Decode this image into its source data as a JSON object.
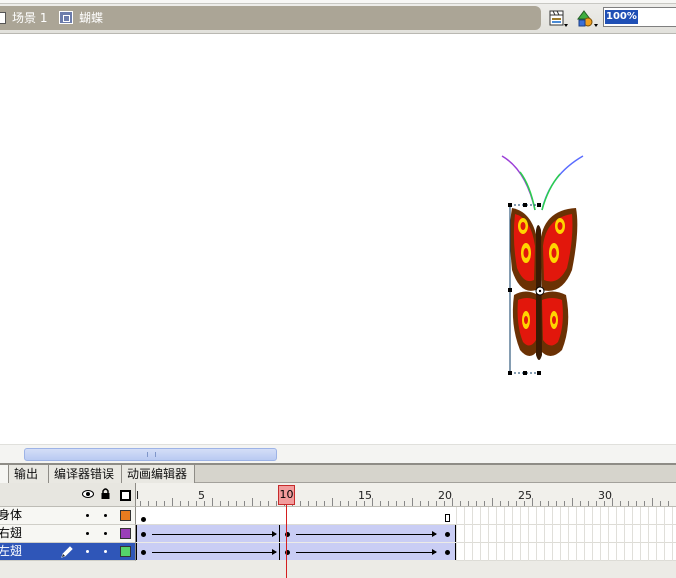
{
  "breadcrumb": {
    "scene": "场景 1",
    "symbol": "蝴蝶"
  },
  "toolbar": {
    "zoom_value": "100%",
    "edit_scene_icon": "clapper-icon",
    "edit_symbol_icon": "shapes-icon"
  },
  "panel_tabs": [
    "",
    "输出",
    "编译器错误",
    "动画编辑器"
  ],
  "timeline": {
    "frame_numbers": [
      "l",
      "5",
      "10",
      "15",
      "20",
      "25",
      "30"
    ],
    "current_frame": "10",
    "layers": [
      {
        "name": "身体",
        "color": "#e87b1f"
      },
      {
        "name": "右翅",
        "color": "#9a3fb8"
      },
      {
        "name": "左翅",
        "color": "#55d36a",
        "selected": true
      }
    ]
  },
  "colors": {
    "selection": "#2f56b8",
    "tween": "#c9cdf4",
    "playhead": "#d41f1f"
  }
}
